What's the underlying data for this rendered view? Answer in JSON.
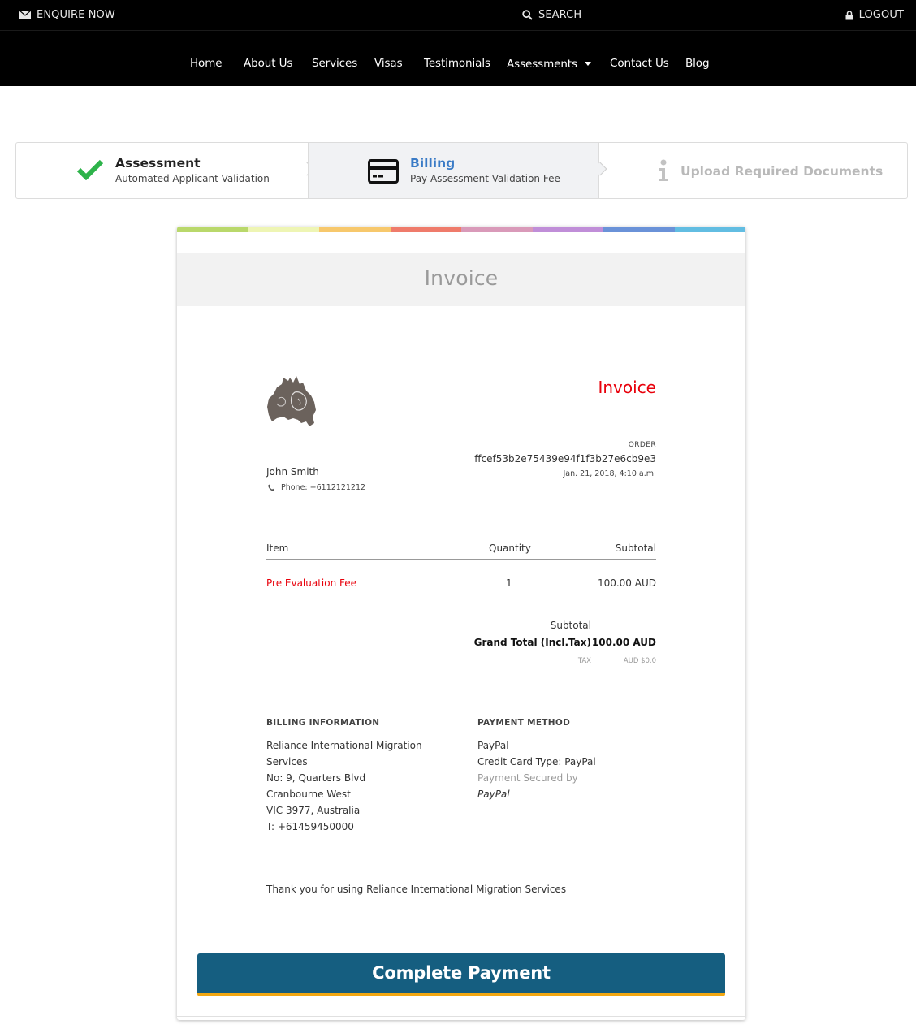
{
  "header": {
    "enquire_label": "ENQUIRE NOW",
    "search_label": "SEARCH",
    "logout_label": "LOGOUT",
    "nav": [
      "Home",
      "About Us",
      "Services",
      "Visas",
      "Testimonials",
      "Assessments",
      "Contact Us",
      "Blog"
    ]
  },
  "steps": [
    {
      "title": "Assessment",
      "subtitle": "Automated Applicant Validation",
      "state": "complete",
      "icon": "checkmark-icon"
    },
    {
      "title": "Billing",
      "subtitle": "Pay Assessment Validation Fee",
      "state": "active",
      "icon": "credit-card-icon"
    },
    {
      "title": "Upload Required Documents",
      "subtitle": "",
      "state": "upcoming",
      "icon": "info-icon"
    }
  ],
  "invoice": {
    "heading": "Invoice",
    "doc_title": "Invoice",
    "order_label": "ORDER",
    "order_id": "ffcef53b2e75439e94f1f3b27e6cb9e3",
    "order_date": "Jan. 21, 2018, 4:10 a.m.",
    "customer_name": "John Smith",
    "customer_phone": "Phone: +6112121212",
    "table_headers": {
      "item": "Item",
      "quantity": "Quantity",
      "subtotal": "Subtotal"
    },
    "line_items": [
      {
        "item": "Pre Evaluation Fee",
        "quantity": "1",
        "subtotal": "100.00 AUD"
      }
    ],
    "totals": {
      "subtotal_label": "Subtotal",
      "grand_total_label": "Grand Total (Incl.Tax)",
      "grand_total_value": "100.00 AUD",
      "tax_label": "TAX",
      "tax_value": "AUD $0.0"
    },
    "billing_heading": "BILLING INFORMATION",
    "billing_lines": [
      "Reliance International Migration Services",
      "No: 9, Quarters Blvd",
      "Cranbourne West",
      "VIC 3977, Australia",
      "T: +61459450000"
    ],
    "payment_heading": "PAYMENT METHOD",
    "payment_method": "PayPal",
    "card_type": "Credit Card Type: PayPal",
    "secured_by": "Payment Secured by",
    "secured_provider": "PayPal",
    "thank_you": "Thank you for using Reliance International Migration Services",
    "pay_button": "Complete Payment"
  },
  "colors": {
    "accent_red": "#e8000b",
    "active_step_blue": "#3a7bc6",
    "button_blue": "#155e80",
    "button_underline": "#f2a711",
    "check_green": "#2db34a",
    "rainbow": [
      "#b9d86b",
      "#eef5b4",
      "#f7c86c",
      "#ef7b6b",
      "#d99ab9",
      "#c08ed8",
      "#6a92d8",
      "#62bde2"
    ]
  }
}
